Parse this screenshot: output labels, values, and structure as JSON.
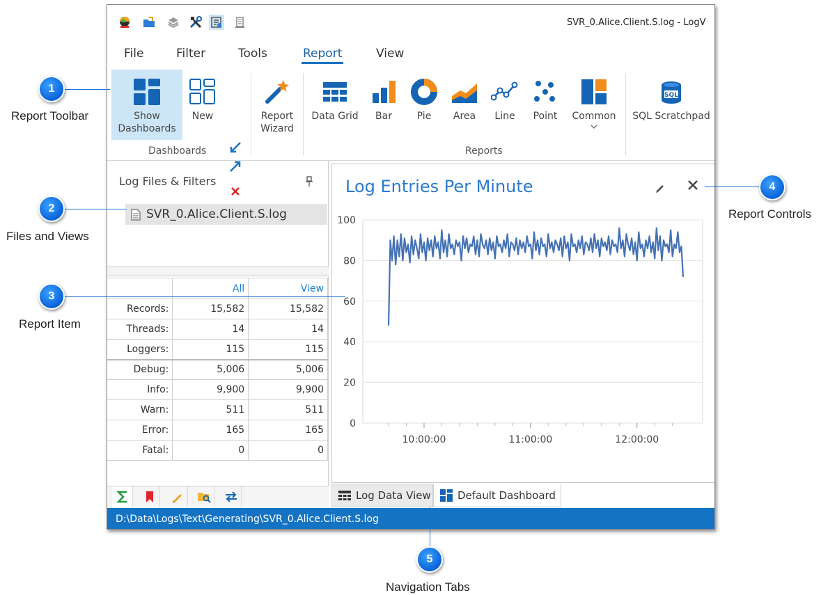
{
  "window": {
    "title": "SVR_0.Alice.Client.S.log - LogV"
  },
  "quick_access": [
    "app-logo-icon",
    "open-folder-icon",
    "layers-icon",
    "tools-icon",
    "dashboard-refresh-icon",
    "document-stack-icon"
  ],
  "menu": {
    "tabs": [
      {
        "label": "File",
        "active": false
      },
      {
        "label": "Filter",
        "active": false
      },
      {
        "label": "Tools",
        "active": false
      },
      {
        "label": "Report",
        "active": true
      },
      {
        "label": "View",
        "active": false
      }
    ]
  },
  "ribbon": {
    "dashboards_group": {
      "label": "Dashboards",
      "show_dashboards": "Show\nDashboards",
      "new": "New"
    },
    "report_wizard": "Report\nWizard",
    "reports_group": {
      "label": "Reports",
      "buttons": [
        "Data Grid",
        "Bar",
        "Pie",
        "Area",
        "Line",
        "Point",
        "Common",
        "SQL Scratchpad"
      ]
    }
  },
  "files_panel": {
    "header": "Log Files & Filters",
    "file": "SVR_0.Alice.Client.S.log"
  },
  "stats": {
    "headers": [
      "",
      "All",
      "View"
    ],
    "rows": [
      {
        "label": "Records:",
        "all": "15,582",
        "view": "15,582"
      },
      {
        "label": "Threads:",
        "all": "14",
        "view": "14"
      },
      {
        "label": "Loggers:",
        "all": "115",
        "view": "115"
      },
      {
        "label": "Debug:",
        "all": "5,006",
        "view": "5,006"
      },
      {
        "label": "Info:",
        "all": "9,900",
        "view": "9,900"
      },
      {
        "label": "Warn:",
        "all": "511",
        "view": "511"
      },
      {
        "label": "Error:",
        "all": "165",
        "view": "165"
      },
      {
        "label": "Fatal:",
        "all": "0",
        "view": "0"
      }
    ]
  },
  "left_tabs": [
    "sigma-icon",
    "bookmark-icon",
    "pencil-icon",
    "folder-search-icon",
    "swap-arrows-icon"
  ],
  "report": {
    "title": "Log Entries Per Minute"
  },
  "chart_data": {
    "type": "line",
    "title": "Log Entries Per Minute",
    "xlabel": "",
    "ylabel": "",
    "ylim": [
      0,
      100
    ],
    "yticks": [
      0,
      20,
      40,
      60,
      80,
      100
    ],
    "xticks": [
      "10:00:00",
      "11:00:00",
      "12:00:00"
    ],
    "x_start_minute_offset": -20,
    "color": "#4472b4",
    "y": [
      48,
      90,
      80,
      92,
      78,
      90,
      82,
      93,
      80,
      91,
      84,
      88,
      79,
      92,
      83,
      90,
      86,
      81,
      93,
      84,
      89,
      80,
      91,
      85,
      90,
      82,
      92,
      86,
      89,
      81,
      95,
      84,
      90,
      82,
      93,
      86,
      88,
      83,
      90,
      87,
      89,
      80,
      92,
      86,
      91,
      84,
      88,
      87,
      92,
      83,
      90,
      82,
      93,
      88,
      86,
      90,
      83,
      91,
      85,
      89,
      81,
      92,
      87,
      88,
      84,
      90,
      86,
      93,
      82,
      89,
      88,
      85,
      91,
      83,
      90,
      86,
      89,
      84,
      92,
      87,
      88,
      81,
      94,
      85,
      90,
      83,
      91,
      87,
      88,
      82,
      93,
      86,
      89,
      84,
      90,
      88,
      85,
      91,
      82,
      92,
      86,
      89,
      80,
      93,
      87,
      88,
      84,
      90,
      86,
      92,
      83,
      89,
      88,
      85,
      91,
      84,
      93,
      86,
      90,
      82,
      91,
      87,
      89,
      85,
      92,
      83,
      90,
      87,
      88,
      84,
      96,
      86,
      90,
      82,
      93,
      88,
      85,
      91,
      83,
      89,
      80,
      94,
      86,
      88,
      82,
      90,
      86,
      92,
      84,
      89,
      81,
      96,
      85,
      92,
      80,
      90,
      87,
      88,
      84,
      95,
      82,
      88,
      86,
      94,
      84,
      87,
      72
    ]
  },
  "bottom_tabs": [
    {
      "label": "Log Data View",
      "active": false
    },
    {
      "label": "Default Dashboard",
      "active": true
    }
  ],
  "status": {
    "path": "D:\\Data\\Logs\\Text\\Generating\\SVR_0.Alice.Client.S.log"
  },
  "callouts": [
    {
      "number": "1",
      "label": "Report Toolbar"
    },
    {
      "number": "2",
      "label": "Files and Views"
    },
    {
      "number": "3",
      "label": "Report Item"
    },
    {
      "number": "4",
      "label": "Report Controls"
    },
    {
      "number": "5",
      "label": "Navigation Tabs"
    }
  ]
}
